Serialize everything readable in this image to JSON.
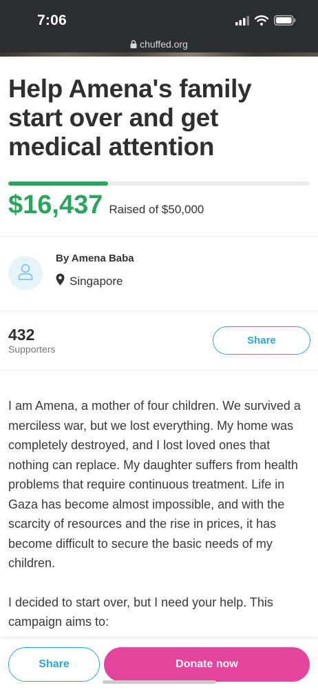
{
  "status_bar": {
    "time": "7:06",
    "url": "chuffed.org",
    "icons": [
      "signal-icon",
      "wifi-icon",
      "battery-icon",
      "lock-icon"
    ]
  },
  "campaign": {
    "title": "Help Amena's family start over and get medical attention",
    "progress_fraction": 0.33,
    "raised_amount": "$16,437",
    "raised_of": "Raised of $50,000"
  },
  "organizer": {
    "name": "By Amena Baba",
    "location": "Singapore",
    "icons": [
      "user-icon",
      "map-pin-icon"
    ]
  },
  "supporters": {
    "count": "432",
    "label": "Supporters",
    "share_label": "Share"
  },
  "story": {
    "paragraphs": [
      "I am Amena, a mother of four children. We survived a merciless war, but we lost everything. My home was completely destroyed, and I lost loved ones that nothing can replace. My daughter suffers from health problems that require continuous treatment. Life in Gaza has become almost impossible, and with the scarcity of resources and the rise in prices, it has become difficult to secure the basic needs of my children.",
      "I decided to start over, but I need your help. This campaign aims to:"
    ]
  },
  "bottom_bar": {
    "share_label": "Share",
    "donate_label": "Donate now"
  },
  "colors": {
    "brand_green": "#27a65c",
    "share_blue": "#2aa7d6",
    "donate_pink": "#e4449c",
    "status_bar_bg": "#2b2d30"
  }
}
